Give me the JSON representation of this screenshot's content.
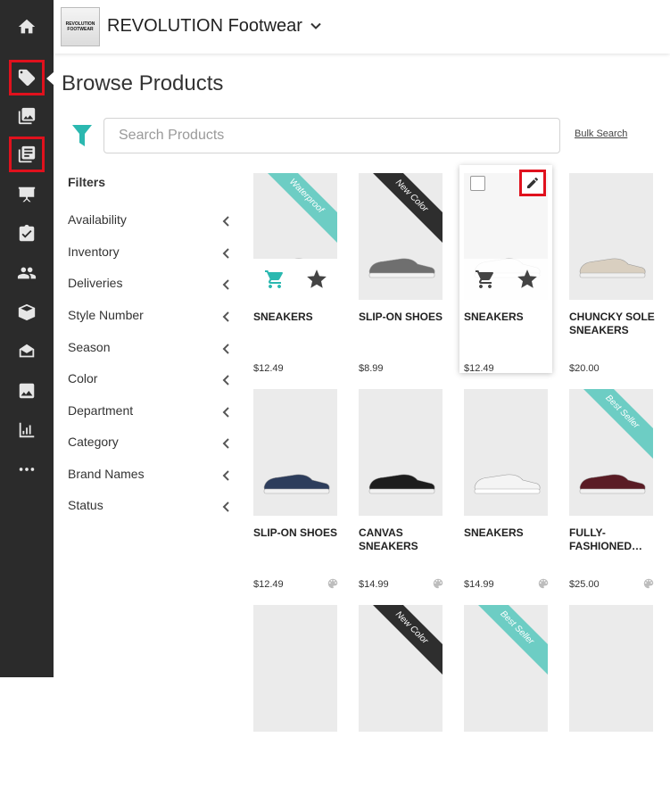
{
  "brand": {
    "logo_text": "REVOLUTION FOOTWEAR",
    "name": "REVOLUTION Footwear"
  },
  "page": {
    "title": "Browse Products"
  },
  "search": {
    "placeholder": "Search Products",
    "value": "",
    "bulk_label": "Bulk Search"
  },
  "filters": {
    "heading": "Filters",
    "items": [
      "Availability",
      "Inventory",
      "Deliveries",
      "Style Number",
      "Season",
      "Color",
      "Department",
      "Category",
      "Brand Names",
      "Status"
    ]
  },
  "sidebar": {
    "items": [
      "home-icon",
      "tag-icon",
      "catalog-icon",
      "line-sheet-icon",
      "presentation-icon",
      "checklist-icon",
      "customers-icon",
      "box-icon",
      "orders-icon",
      "gallery-icon",
      "reports-icon",
      "more-icon"
    ],
    "highlighted": [
      "tag-icon",
      "line-sheet-icon"
    ]
  },
  "products": [
    {
      "name": "SNEAKERS",
      "price": "$12.49",
      "ribbon": "Waterproof",
      "ribbon_color": "#6dcdc4",
      "shoe": "pink"
    },
    {
      "name": "SLIP-ON SHOES",
      "price": "$8.99",
      "ribbon": "New Color",
      "ribbon_color": "#2e2e2e",
      "shoe": "snake"
    },
    {
      "name": "SNEAKERS",
      "price": "$12.49",
      "ribbon": "",
      "shoe": "white"
    },
    {
      "name": "CHUNCKY SOLE SNEAKERS",
      "price": "$20.00",
      "ribbon": "",
      "shoe": "chunky"
    },
    {
      "name": "SLIP-ON SHOES",
      "price": "$12.49",
      "ribbon": "",
      "shoe": "navy"
    },
    {
      "name": "CANVAS SNEAKERS",
      "price": "$14.99",
      "ribbon": "",
      "shoe": "black"
    },
    {
      "name": "SNEAKERS",
      "price": "$14.99",
      "ribbon": "",
      "shoe": "white"
    },
    {
      "name": "FULLY-FASHIONED…",
      "price": "$25.00",
      "ribbon": "Best Seller",
      "ribbon_color": "#6dcdc4",
      "shoe": "knit"
    },
    {
      "name": "",
      "price": "",
      "ribbon": "",
      "shoe": ""
    },
    {
      "name": "",
      "price": "",
      "ribbon": "New Color",
      "ribbon_color": "#2e2e2e",
      "shoe": ""
    },
    {
      "name": "",
      "price": "",
      "ribbon": "Best Seller",
      "ribbon_color": "#6dcdc4",
      "shoe": ""
    },
    {
      "name": "",
      "price": "",
      "ribbon": "",
      "shoe": ""
    }
  ],
  "colors": {
    "accent": "#2bb8b0",
    "highlight": "#e0111d",
    "sidebar": "#2b2b2b"
  }
}
